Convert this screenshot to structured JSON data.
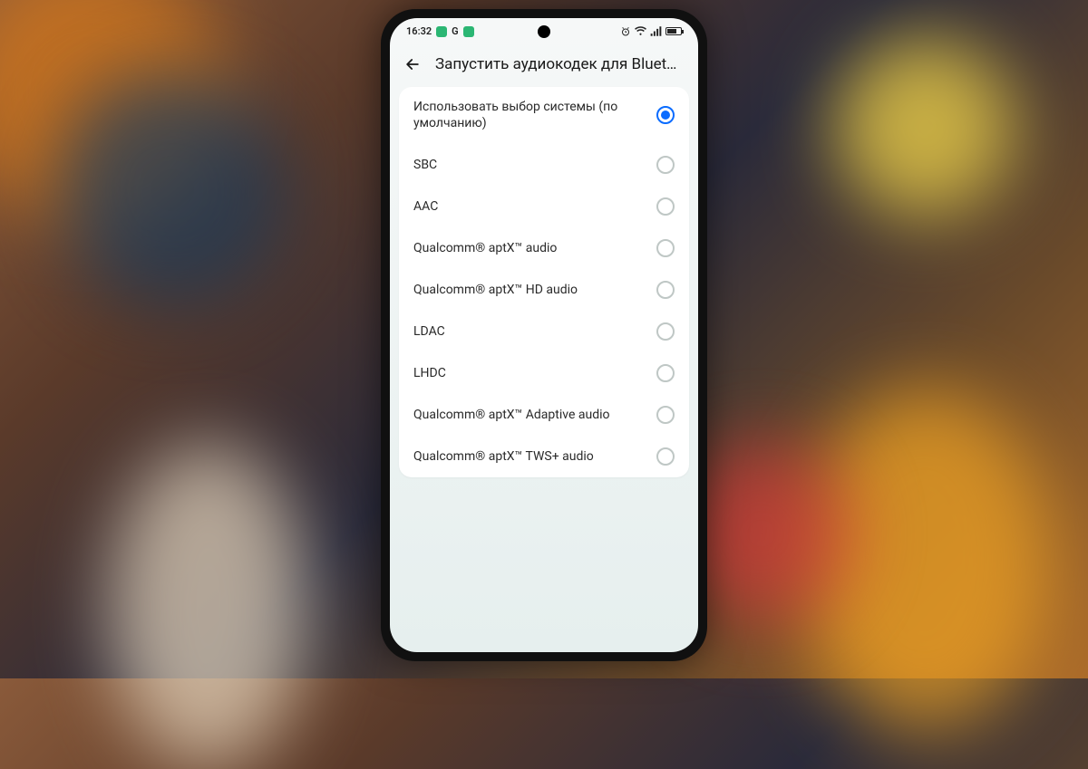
{
  "statusbar": {
    "time": "16:32",
    "indicator_g": "G",
    "square1_color": "#2bb673",
    "square2_color": "#2bb673"
  },
  "header": {
    "title": "Запустить аудиокодек для Blueto…"
  },
  "options": [
    {
      "label": "Использовать выбор системы (по умолчанию)",
      "selected": true
    },
    {
      "label": "SBC",
      "selected": false
    },
    {
      "label": "AAC",
      "selected": false
    },
    {
      "label": "Qualcomm® aptX™ audio",
      "selected": false
    },
    {
      "label": "Qualcomm® aptX™ HD audio",
      "selected": false
    },
    {
      "label": "LDAC",
      "selected": false
    },
    {
      "label": "LHDC",
      "selected": false
    },
    {
      "label": "Qualcomm® aptX™ Adaptive audio",
      "selected": false
    },
    {
      "label": "Qualcomm® aptX™ TWS+ audio",
      "selected": false
    }
  ]
}
